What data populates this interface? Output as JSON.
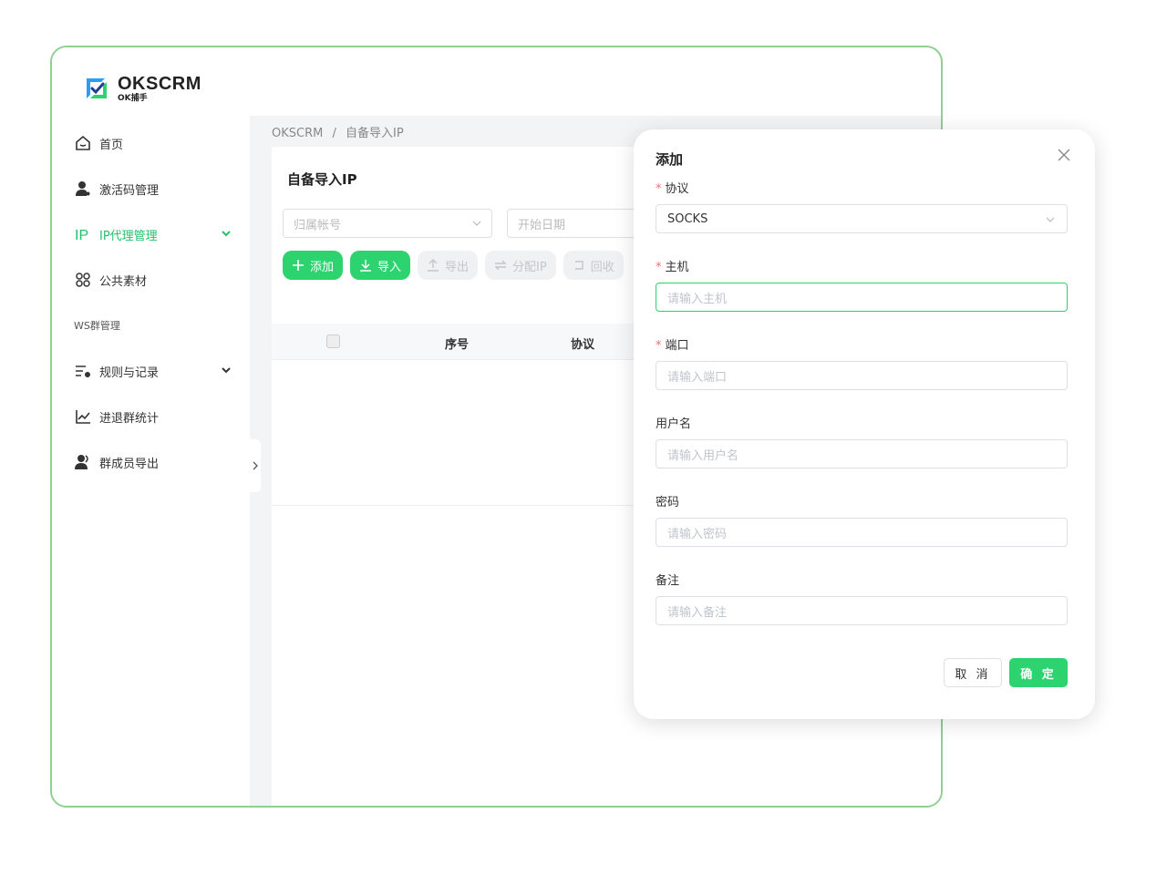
{
  "brand": {
    "name": "OKSCRM",
    "sub": "OK捕手",
    "accent": "#2dd36f"
  },
  "sidebar": {
    "items": [
      {
        "label": "首页",
        "icon": "home-icon"
      },
      {
        "label": "激活码管理",
        "icon": "user-key-icon"
      },
      {
        "label": "IP代理管理",
        "icon": "ip-icon",
        "active": true
      },
      {
        "label": "公共素材",
        "icon": "apps-icon"
      }
    ],
    "group_label": "WS群管理",
    "group_items": [
      {
        "label": "规则与记录",
        "icon": "rules-icon"
      },
      {
        "label": "进退群统计",
        "icon": "stats-chart-icon"
      },
      {
        "label": "群成员导出",
        "icon": "members-icon"
      }
    ]
  },
  "breadcrumb": {
    "root": "OKSCRM",
    "sep": "/",
    "current": "自备导入IP"
  },
  "page": {
    "title": "自备导入IP",
    "filters": {
      "account_placeholder": "归属帐号",
      "date_placeholder": "开始日期"
    },
    "buttons": {
      "add": "添加",
      "import": "导入",
      "export": "导出",
      "assign": "分配IP",
      "recycle": "回收"
    },
    "table": {
      "columns": [
        "序号",
        "协议"
      ]
    }
  },
  "dialog": {
    "title": "添加",
    "protocol": {
      "label": "协议",
      "value": "SOCKS"
    },
    "host": {
      "label": "主机",
      "placeholder": "请输入主机"
    },
    "port": {
      "label": "端口",
      "placeholder": "请输入端口"
    },
    "username": {
      "label": "用户名",
      "placeholder": "请输入用户名"
    },
    "password": {
      "label": "密码",
      "placeholder": "请输入密码"
    },
    "remark": {
      "label": "备注",
      "placeholder": "请输入备注"
    },
    "cancel": "取 消",
    "confirm": "确 定"
  }
}
